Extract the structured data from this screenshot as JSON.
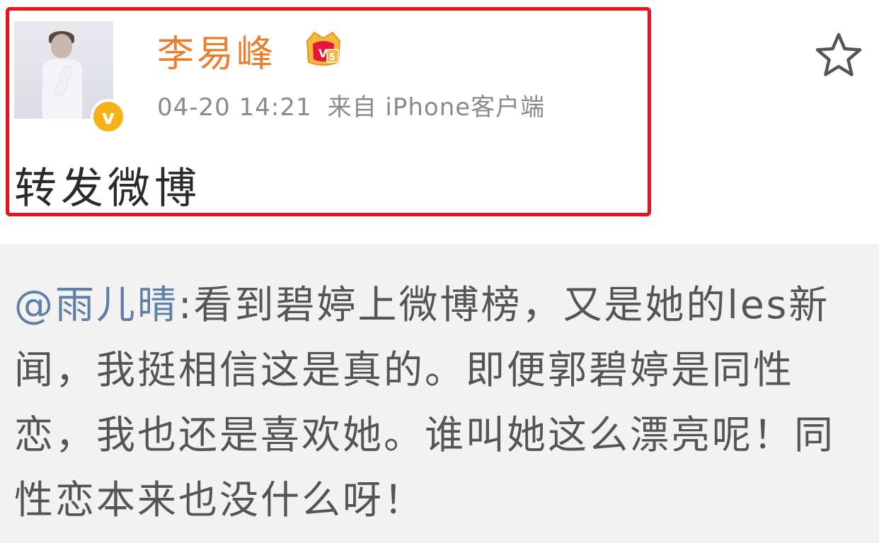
{
  "post": {
    "username": "李易峰",
    "time": "04-20 14:21",
    "source_label": "来自 iPhone客户端",
    "text": "转发微博",
    "verified_icon": "verified-v-icon",
    "verified_letter": "v",
    "vip_icon": "vip-crown-icon",
    "star_icon": "star-outline-icon"
  },
  "retweet": {
    "mention": "@雨儿晴",
    "text": ":看到碧婷上微博榜，又是她的les新闻，我挺相信这是真的。即便郭碧婷是同性恋，我也还是喜欢她。谁叫她这么漂亮呢！同性恋本来也没什么呀！"
  },
  "colors": {
    "highlight": "#e8141c",
    "username": "#e87e2e",
    "mention": "#5d7fa8",
    "badge": "#f5b21a"
  }
}
